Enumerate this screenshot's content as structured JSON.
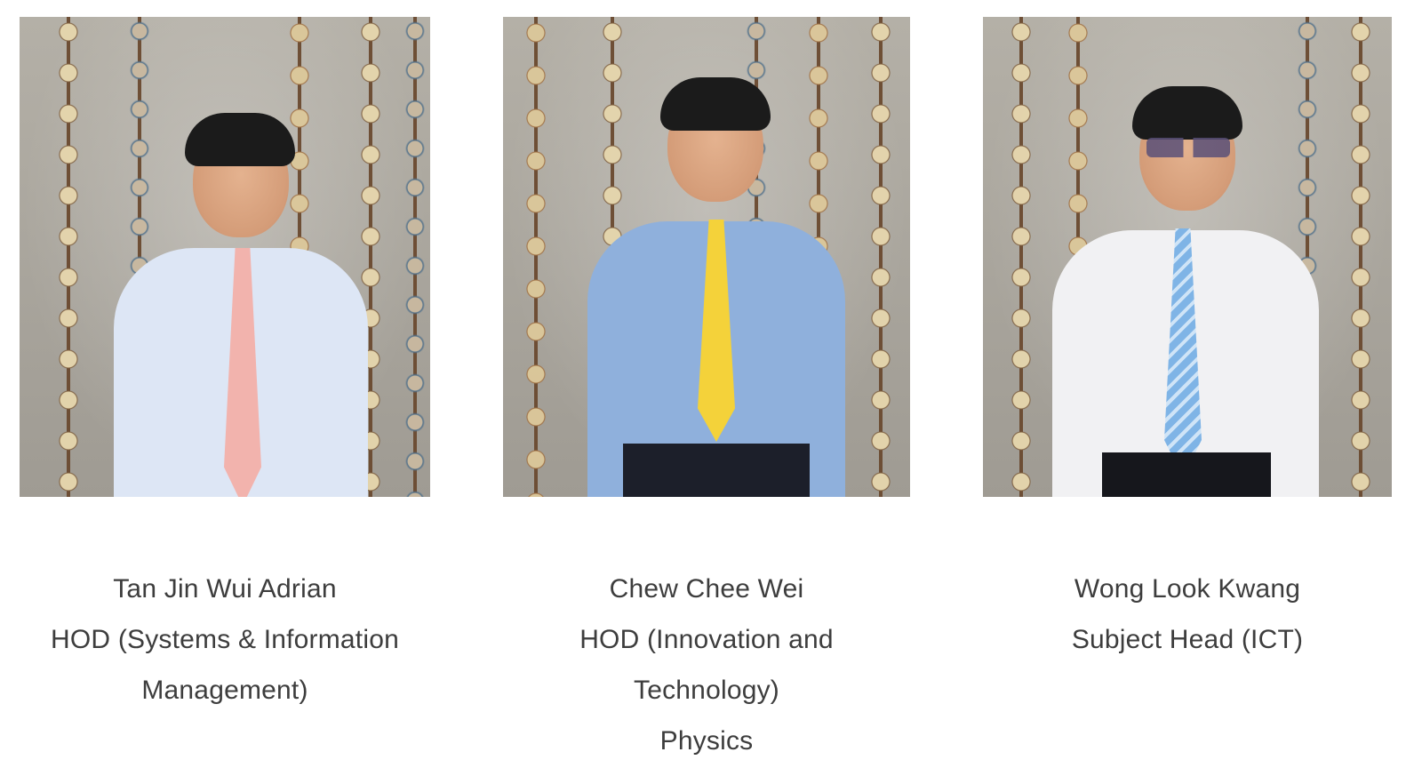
{
  "staff": [
    {
      "name": "Tan Jin Wui Adrian",
      "role_lines": [
        "HOD (Systems & Information",
        "Management)"
      ],
      "photo": {
        "alt": "Tan Jin Wui Adrian",
        "shirt_color": "#dde6f5",
        "tie_color": "#f2b3ad"
      }
    },
    {
      "name": "Chew Chee Wei",
      "role_lines": [
        "HOD (Innovation and",
        "Technology)",
        "Physics"
      ],
      "photo": {
        "alt": "Chew Chee Wei",
        "shirt_color": "#8fb0dc",
        "tie_color": "#f4d23a"
      }
    },
    {
      "name": "Wong Look Kwang",
      "role_lines": [
        "Subject Head (ICT)"
      ],
      "photo": {
        "alt": "Wong Look Kwang",
        "shirt_color": "#f1f1f3",
        "tie_color": "#7fb4e6"
      }
    }
  ]
}
